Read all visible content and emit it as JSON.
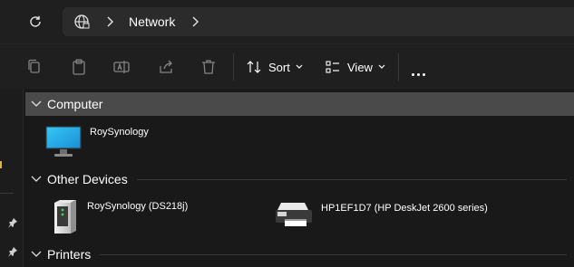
{
  "address": {
    "crumb": "Network"
  },
  "toolbar": {
    "sort_label": "Sort",
    "view_label": "View"
  },
  "groups": [
    {
      "title": "Computer",
      "items": [
        {
          "label": "RoySynology",
          "icon": "monitor-icon"
        }
      ]
    },
    {
      "title": "Other Devices",
      "items": [
        {
          "label": "RoySynology (DS218j)",
          "icon": "nas-icon"
        },
        {
          "label": "HP1EF1D7 (HP DeskJet 2600 series)",
          "icon": "printer-icon"
        }
      ]
    },
    {
      "title": "Printers",
      "items": []
    }
  ],
  "colors": {
    "selected_group": "#4a4a4a",
    "background": "#191919",
    "nav_marker": "#e3b341"
  }
}
